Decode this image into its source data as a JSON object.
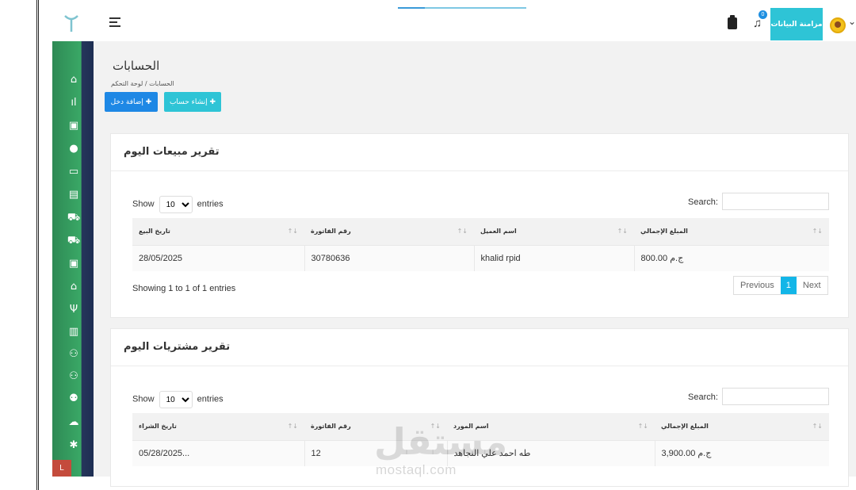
{
  "topbar": {
    "sync_label": "مزامنة البيانات",
    "notification_count": "0"
  },
  "sidebar": {
    "items": [
      {
        "icon": "home-icon",
        "glyph": "⌂"
      },
      {
        "icon": "stats-icon",
        "glyph": "ıl"
      },
      {
        "icon": "medkit-icon",
        "glyph": "▣"
      },
      {
        "icon": "user-icon",
        "glyph": "●"
      },
      {
        "icon": "card-icon",
        "glyph": "▭"
      },
      {
        "icon": "file-icon",
        "glyph": "▤"
      },
      {
        "icon": "cart-icon",
        "glyph": "⛟"
      },
      {
        "icon": "truck-icon",
        "glyph": "⛟"
      },
      {
        "icon": "medkit-icon",
        "glyph": "▣"
      },
      {
        "icon": "lock-icon",
        "glyph": "⌂"
      },
      {
        "icon": "tree-icon",
        "glyph": "Ψ"
      },
      {
        "icon": "building-icon",
        "glyph": "▥"
      },
      {
        "icon": "users-icon",
        "glyph": "⚇"
      },
      {
        "icon": "users-icon",
        "glyph": "⚇"
      },
      {
        "icon": "user-plus-icon",
        "glyph": "⚉"
      },
      {
        "icon": "cloud-upload-icon",
        "glyph": "☁"
      },
      {
        "icon": "gear-icon",
        "glyph": "✱"
      }
    ]
  },
  "page": {
    "title": "الحسابات",
    "breadcrumb": "الحسابات / لوحة التحكم",
    "add_entry_label": "إضافة دخل ✚",
    "create_account_label": "إنشاء حساب ✚"
  },
  "sales": {
    "title": "تقرير مبيعات اليوم",
    "show_label": "Show",
    "entries_label": "entries",
    "page_length": "10",
    "search_label": "Search:",
    "columns": [
      "تاريخ البيع",
      "رقم الفاتورة",
      "اسم العميل",
      "المبلغ الإجمالي"
    ],
    "rows": [
      [
        "28/05/2025",
        "30780636",
        "khalid rpid",
        "800.00 ج.م"
      ]
    ],
    "info": "Showing 1 to 1 of 1 entries",
    "prev": "Previous",
    "page": "1",
    "next": "Next"
  },
  "purchases": {
    "title": "تقرير مشتريات اليوم",
    "show_label": "Show",
    "entries_label": "entries",
    "page_length": "10",
    "search_label": "Search:",
    "columns": [
      "تاريخ الشراء",
      "رقم الفاتورة",
      "اسم المورد",
      "المبلغ الإجمالي"
    ],
    "rows": [
      [
        "05/28/2025...",
        "12",
        "طه احمد علي النجاهد",
        "3,900.00 ج.م"
      ]
    ]
  },
  "watermark": {
    "arabic": "مستقل",
    "latin": "mostaql.com"
  }
}
